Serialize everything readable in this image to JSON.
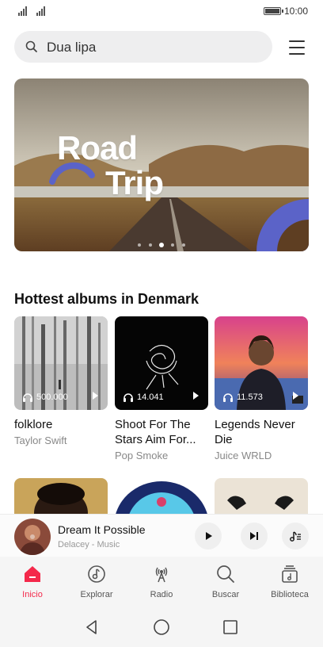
{
  "status_bar": {
    "time": "10:00"
  },
  "search": {
    "query": "Dua lipa"
  },
  "banner": {
    "title_line1": "Road",
    "title_line2": "Trip",
    "slides": 5,
    "active_slide": 3
  },
  "section": {
    "title": "Hottest albums in Denmark"
  },
  "albums": [
    {
      "title": "folklore",
      "artist": "Taylor Swift",
      "plays": "500.000"
    },
    {
      "title": "Shoot For The Stars Aim For...",
      "artist": "Pop Smoke",
      "plays": "14.041"
    },
    {
      "title": "Legends Never Die",
      "artist": "Juice WRLD",
      "plays": "11.573"
    }
  ],
  "mini_player": {
    "title": "Dream It Possible",
    "subtitle": "Delacey - Music"
  },
  "tabs": [
    {
      "label": "Inicio",
      "icon": "home-icon",
      "active": true
    },
    {
      "label": "Explorar",
      "icon": "music-disc-icon",
      "active": false
    },
    {
      "label": "Radio",
      "icon": "radio-tower-icon",
      "active": false
    },
    {
      "label": "Buscar",
      "icon": "search-icon",
      "active": false
    },
    {
      "label": "Biblioteca",
      "icon": "library-icon",
      "active": false
    }
  ],
  "colors": {
    "accent": "#f4294b",
    "search_bg": "#eeeeef",
    "tab_bar_bg": "#f5f5f5"
  }
}
